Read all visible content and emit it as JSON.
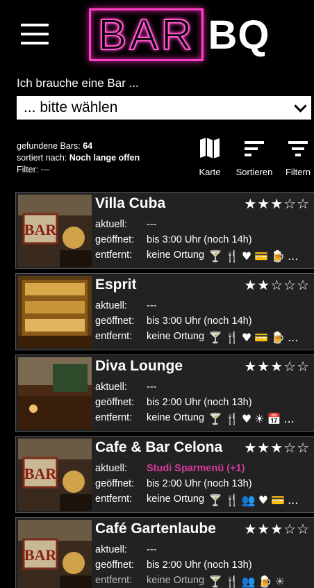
{
  "header": {
    "logo_left": "BAR",
    "logo_right": "BQ"
  },
  "prompt": "Ich brauche eine Bar ...",
  "select": {
    "value": "... bitte wählen"
  },
  "info": {
    "found_label": "gefundene Bars:",
    "found_count": "64",
    "sort_label": "sortiert nach:",
    "sort_value": "Noch lange offen",
    "filter_label": "Filter:",
    "filter_value": "---"
  },
  "toolbar": {
    "map_label": "Karte",
    "sort_label": "Sortieren",
    "filter_label": "Filtern"
  },
  "labels": {
    "current": "aktuell:",
    "open": "geöffnet:",
    "distance": "entfernt:"
  },
  "bars": [
    {
      "name": "Villa Cuba",
      "stars": "★★★☆☆",
      "current": "---",
      "open": "bis 3:00 Uhr (noch 14h)",
      "distance": "keine Ortung",
      "icons": [
        "cocktail-icon",
        "cutlery-icon",
        "heart-icon",
        "card-icon",
        "beer-icon"
      ],
      "glyphs": [
        "🍸",
        "🍴",
        "♥",
        "💳",
        "🍺"
      ],
      "more": "..."
    },
    {
      "name": "Esprit",
      "stars": "★★☆☆☆",
      "current": "---",
      "open": "bis 3:00 Uhr (noch 14h)",
      "distance": "keine Ortung",
      "icons": [
        "cocktail-icon",
        "cutlery-icon",
        "heart-icon",
        "card-icon",
        "beer-icon"
      ],
      "glyphs": [
        "🍸",
        "🍴",
        "♥",
        "💳",
        "🍺"
      ],
      "more": "..."
    },
    {
      "name": "Diva Lounge",
      "stars": "★★★☆☆",
      "current": "---",
      "open": "bis 2:00 Uhr (noch 13h)",
      "distance": "keine Ortung",
      "icons": [
        "cocktail-icon",
        "cutlery-icon",
        "heart-icon",
        "sun-icon",
        "calendar-icon"
      ],
      "glyphs": [
        "🍸",
        "🍴",
        "♥",
        "☀",
        "📅"
      ],
      "more": "..."
    },
    {
      "name": "Cafe & Bar Celona",
      "stars": "★★★☆☆",
      "current": "Studi Sparmenü (+1)",
      "current_promo": true,
      "open": "bis 2:00 Uhr (noch 13h)",
      "distance": "keine Ortung",
      "icons": [
        "cocktail-icon",
        "cutlery-icon",
        "group-icon",
        "heart-icon",
        "card-icon"
      ],
      "glyphs": [
        "🍸",
        "🍴",
        "👥",
        "♥",
        "💳"
      ],
      "more": "..."
    },
    {
      "name": "Café Gartenlaube",
      "stars": "★★★☆☆",
      "current": "---",
      "open": "bis 2:00 Uhr (noch 13h)",
      "distance": "keine Ortung",
      "icons": [
        "cocktail-icon",
        "cutlery-icon",
        "group-icon",
        "beer-icon",
        "sun-icon"
      ],
      "glyphs": [
        "🍸",
        "🍴",
        "👥",
        "🍺",
        "☀"
      ],
      "more": "..."
    }
  ],
  "colors": {
    "accent": "#d63a9b",
    "neon": "#ff3fc8",
    "card_bg": "#222222"
  }
}
